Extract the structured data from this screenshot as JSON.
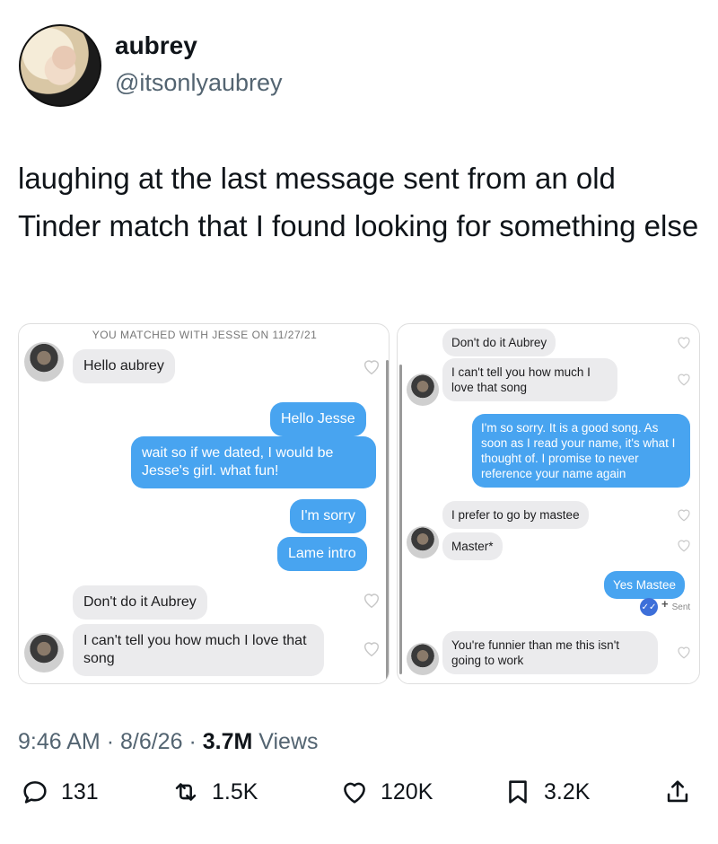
{
  "author": {
    "name": "aubrey",
    "handle": "@itsonlyaubrey"
  },
  "tweet": {
    "text": "laughing at the last message sent from an old Tinder match that I found looking for something else"
  },
  "screenshot_left": {
    "header": "YOU MATCHED WITH JESSE ON 11/27/21",
    "messages": [
      {
        "text": "Hello aubrey"
      },
      {
        "text": "Hello Jesse"
      },
      {
        "text": "wait so if we dated, I would be Jesse's girl. what fun!"
      },
      {
        "text": "I'm sorry"
      },
      {
        "text": "Lame intro"
      },
      {
        "text": "Don't do it Aubrey"
      },
      {
        "text": "I can't tell you how much I love that song"
      }
    ]
  },
  "screenshot_right": {
    "messages": [
      {
        "text": "Don't do it Aubrey"
      },
      {
        "text": "I can't tell you how much I love that song"
      },
      {
        "text": "I'm so sorry. It is a good song. As soon as I read your name, it's what I thought of. I promise to never reference your name again"
      },
      {
        "text": "I prefer to go by mastee"
      },
      {
        "text": "Master*"
      },
      {
        "text": "Yes Mastee"
      },
      {
        "text": "You're funnier than me this isn't going to work"
      }
    ],
    "sent_label": "Sent"
  },
  "meta": {
    "time": "9:46 AM",
    "date": "8/6/26",
    "views_count": "3.7M",
    "views_label": "Views"
  },
  "actions": {
    "replies": "131",
    "reposts": "1.5K",
    "likes": "120K",
    "bookmarks": "3.2K"
  },
  "colors": {
    "outgoing_bubble": "#48a4f0",
    "incoming_bubble": "#ebebed",
    "secondary_text": "#536471"
  }
}
